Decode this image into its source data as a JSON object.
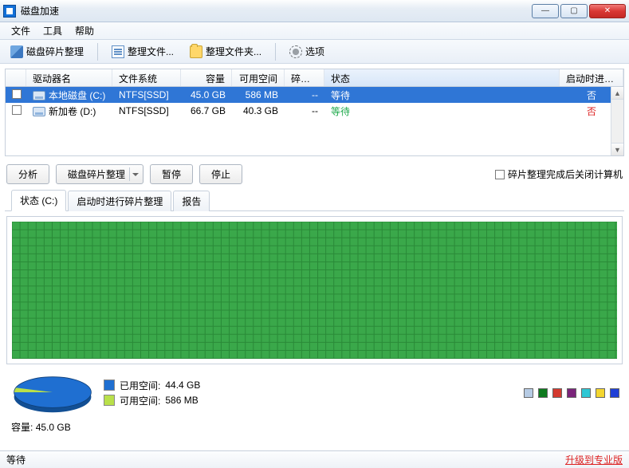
{
  "window": {
    "title": "磁盘加速"
  },
  "menu": {
    "file": "文件",
    "tools": "工具",
    "help": "帮助"
  },
  "toolbar": {
    "defrag": "磁盘碎片整理",
    "arrange_files": "整理文件...",
    "arrange_folder": "整理文件夹...",
    "options": "选项"
  },
  "columns": {
    "drive": "驱动器名",
    "fs": "文件系统",
    "cap": "容量",
    "free": "可用空间",
    "frag": "碎片率",
    "status": "状态",
    "boot": "启动时进行碎..."
  },
  "drives": [
    {
      "name": "本地磁盘 (C:)",
      "fs": "NTFS[SSD]",
      "cap": "45.0 GB",
      "free": "586 MB",
      "frag": "--",
      "status": "等待",
      "boot": "否",
      "selected": true
    },
    {
      "name": "新加卷 (D:)",
      "fs": "NTFS[SSD]",
      "cap": "66.7 GB",
      "free": "40.3 GB",
      "frag": "--",
      "status": "等待",
      "boot": "否",
      "selected": false
    }
  ],
  "actions": {
    "analyze": "分析",
    "defrag": "磁盘碎片整理",
    "pause": "暂停",
    "stop": "停止",
    "shutdown_after": "碎片整理完成后关闭计算机"
  },
  "tabs": {
    "status": "状态 (C:)",
    "boot_defrag": "启动时进行碎片整理",
    "report": "报告"
  },
  "usage": {
    "used_label": "已用空间:",
    "used_value": "44.4 GB",
    "used_color": "#1f6fd1",
    "free_label": "可用空间:",
    "free_value": "586 MB",
    "free_color": "#b9e04a",
    "cap_label": "容量:",
    "cap_value": "45.0 GB"
  },
  "colorbar": [
    "#b6cbe4",
    "#0e7a1e",
    "#d43a2f",
    "#7a247a",
    "#2fc7d4",
    "#f4d62f",
    "#1f3fd6"
  ],
  "status": {
    "waiting": "等待",
    "upgrade": "升级到专业版"
  },
  "chart_data": {
    "type": "pie",
    "title": "",
    "series": [
      {
        "name": "已用空间",
        "value": 44.4,
        "unit": "GB",
        "color": "#1f6fd1"
      },
      {
        "name": "可用空间",
        "value": 0.586,
        "unit": "GB",
        "color": "#b9e04a"
      }
    ],
    "total": 45.0
  }
}
